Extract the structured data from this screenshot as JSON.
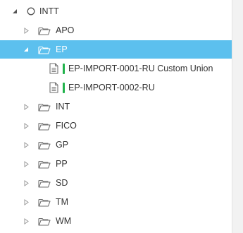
{
  "colors": {
    "selection": "#5cc0ee",
    "status_green": "#21b24b",
    "icon_gray": "#6f6f6f",
    "text": "#333333"
  },
  "tree": {
    "root": {
      "label": "INTT",
      "expanded": true,
      "icon": "circle-icon"
    },
    "nodes": [
      {
        "label": "APO",
        "expanded": false,
        "icon": "folder-icon"
      },
      {
        "label": "EP",
        "expanded": true,
        "selected": true,
        "icon": "folder-icon",
        "children": [
          {
            "label": "EP-IMPORT-0001-RU Custom Union",
            "icon": "document-icon",
            "status": "green"
          },
          {
            "label": "EP-IMPORT-0002-RU",
            "icon": "document-icon",
            "status": "green"
          }
        ]
      },
      {
        "label": "INT",
        "expanded": false,
        "icon": "folder-icon"
      },
      {
        "label": "FICO",
        "expanded": false,
        "icon": "folder-icon"
      },
      {
        "label": "GP",
        "expanded": false,
        "icon": "folder-icon"
      },
      {
        "label": "PP",
        "expanded": false,
        "icon": "folder-icon"
      },
      {
        "label": "SD",
        "expanded": false,
        "icon": "folder-icon"
      },
      {
        "label": "TM",
        "expanded": false,
        "icon": "folder-icon"
      },
      {
        "label": "WM",
        "expanded": false,
        "icon": "folder-icon"
      }
    ]
  }
}
